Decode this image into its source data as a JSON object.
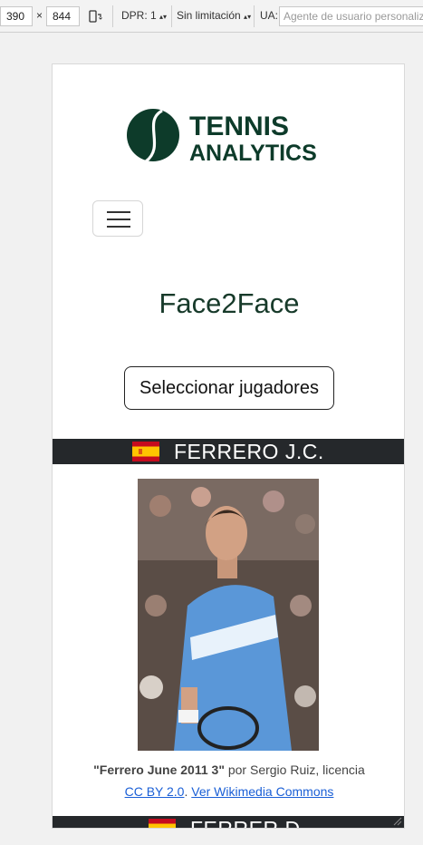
{
  "devtools": {
    "width": "390",
    "times": "×",
    "height": "844",
    "dpr_label": "DPR: 1",
    "throttle_label": "Sin limitación",
    "ua_label": "UA:",
    "ua_placeholder": "Agente de usuario personalizado"
  },
  "header": {
    "logo_line1": "TENNIS",
    "logo_line2": "ANALYTICS",
    "brand_color": "#0d3b2a"
  },
  "page": {
    "title": "Face2Face",
    "select_button": "Seleccionar jugadores"
  },
  "players": [
    {
      "name": "FERRERO J.C.",
      "flag": "spain-flag-icon",
      "photo_credit_title": "\"Ferrero June 2011 3\"",
      "photo_credit_rest": " por Sergio Ruiz, licencia",
      "license_link": "CC BY 2.0",
      "separator": ". ",
      "commons_link": "Ver Wikimedia Commons"
    },
    {
      "name": "FERRER D.",
      "flag": "spain-flag-icon"
    }
  ]
}
